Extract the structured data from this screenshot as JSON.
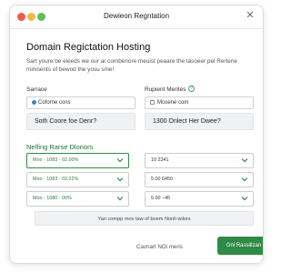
{
  "window": {
    "title": "Dewieon Regntation"
  },
  "header": {
    "title": "Domain Regictation Hosting",
    "subtitle": "Sart youre be eleeds we our ar combenore meuist peaare the tasoeer pel Rertene minisents of bewod the yosu sme!"
  },
  "form": {
    "left_label": "Sarrace",
    "left_input": "Coforne cons",
    "right_label": "Rupient Merites",
    "right_input": "Mcoene com",
    "left_question": "Soth Coore foe Denr?",
    "right_question": "1300 Onlect Her Dwee?"
  },
  "section": {
    "title": "Nelfing Rarse Dlonors",
    "left_rows": [
      "Moo · 1083 · 02.00%",
      "Moo · 1083 · 03.22%",
      "Moo · 1080 · 00%"
    ],
    "right_rows": [
      "10 2341",
      "5.00 6450",
      "5.00 −45"
    ]
  },
  "info": {
    "text": "Yan compp mov taw of boem Nonli wilors"
  },
  "footer": {
    "link": "Cavnart NOi meris",
    "button": "Gnl Rassillzan"
  },
  "icons": {
    "help": "help-circle-icon",
    "close": "close-icon",
    "chevron": "chevron-down-icon"
  },
  "colors": {
    "accent": "#2f8a45",
    "radio": "#3f86c8"
  }
}
